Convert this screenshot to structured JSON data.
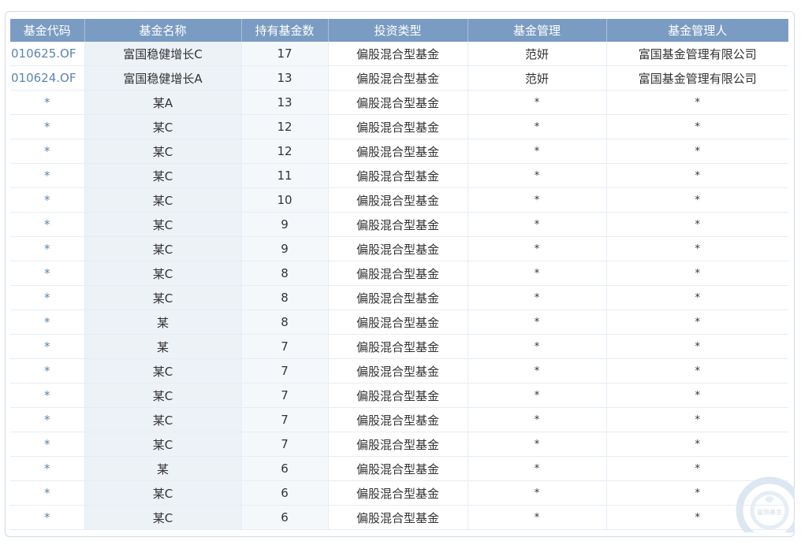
{
  "table": {
    "headers": [
      "基金代码",
      "基金名称",
      "持有基金数",
      "投资类型",
      "基金管理",
      "基金管理人"
    ],
    "rows": [
      {
        "code": "010625.OF",
        "name": "富国稳健增长C",
        "count": "17",
        "type": "偏股混合型基金",
        "manager": "范妍",
        "company": "富国基金管理有限公司"
      },
      {
        "code": "010624.OF",
        "name": "富国稳健增长A",
        "count": "13",
        "type": "偏股混合型基金",
        "manager": "范妍",
        "company": "富国基金管理有限公司"
      },
      {
        "code": "*",
        "name": "某A",
        "count": "13",
        "type": "偏股混合型基金",
        "manager": "*",
        "company": "*"
      },
      {
        "code": "*",
        "name": "某C",
        "count": "12",
        "type": "偏股混合型基金",
        "manager": "*",
        "company": "*"
      },
      {
        "code": "*",
        "name": "某C",
        "count": "12",
        "type": "偏股混合型基金",
        "manager": "*",
        "company": "*"
      },
      {
        "code": "*",
        "name": "某C",
        "count": "11",
        "type": "偏股混合型基金",
        "manager": "*",
        "company": "*"
      },
      {
        "code": "*",
        "name": "某C",
        "count": "10",
        "type": "偏股混合型基金",
        "manager": "*",
        "company": "*"
      },
      {
        "code": "*",
        "name": "某C",
        "count": "9",
        "type": "偏股混合型基金",
        "manager": "*",
        "company": "*"
      },
      {
        "code": "*",
        "name": "某C",
        "count": "9",
        "type": "偏股混合型基金",
        "manager": "*",
        "company": "*"
      },
      {
        "code": "*",
        "name": "某C",
        "count": "8",
        "type": "偏股混合型基金",
        "manager": "*",
        "company": "*"
      },
      {
        "code": "*",
        "name": "某C",
        "count": "8",
        "type": "偏股混合型基金",
        "manager": "*",
        "company": "*"
      },
      {
        "code": "*",
        "name": "某",
        "count": "8",
        "type": "偏股混合型基金",
        "manager": "*",
        "company": "*"
      },
      {
        "code": "*",
        "name": "某",
        "count": "7",
        "type": "偏股混合型基金",
        "manager": "*",
        "company": "*"
      },
      {
        "code": "*",
        "name": "某C",
        "count": "7",
        "type": "偏股混合型基金",
        "manager": "*",
        "company": "*"
      },
      {
        "code": "*",
        "name": "某C",
        "count": "7",
        "type": "偏股混合型基金",
        "manager": "*",
        "company": "*"
      },
      {
        "code": "*",
        "name": "某C",
        "count": "7",
        "type": "偏股混合型基金",
        "manager": "*",
        "company": "*"
      },
      {
        "code": "*",
        "name": "某C",
        "count": "7",
        "type": "偏股混合型基金",
        "manager": "*",
        "company": "*"
      },
      {
        "code": "*",
        "name": "某",
        "count": "6",
        "type": "偏股混合型基金",
        "manager": "*",
        "company": "*"
      },
      {
        "code": "*",
        "name": "某C",
        "count": "6",
        "type": "偏股混合型基金",
        "manager": "*",
        "company": "*"
      },
      {
        "code": "*",
        "name": "某C",
        "count": "6",
        "type": "偏股混合型基金",
        "manager": "*",
        "company": "*"
      }
    ]
  },
  "watermark": {
    "text": "富国基金",
    "icon": "fullgoal-logo-icon"
  },
  "colors": {
    "header_bg": "#7b9cc2",
    "code_text": "#5b84b0",
    "name_col_bg": "#edf2f7"
  }
}
